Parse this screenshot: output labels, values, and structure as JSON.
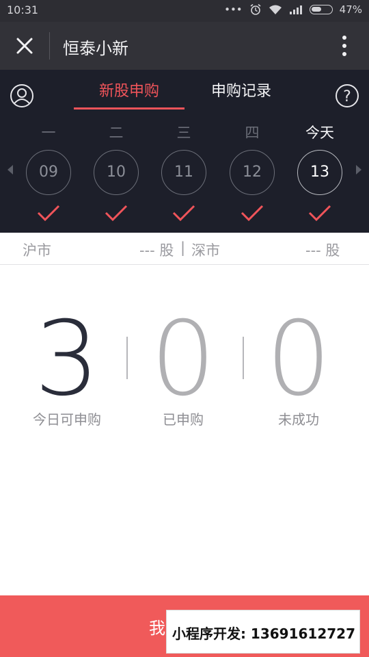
{
  "status": {
    "time": "10:31",
    "battery": "47%"
  },
  "nav": {
    "title": "恒泰小新"
  },
  "tabs": {
    "new_ipo": "新股申购",
    "records": "申购记录"
  },
  "days": [
    {
      "weekday": "一",
      "date": "09"
    },
    {
      "weekday": "二",
      "date": "10"
    },
    {
      "weekday": "三",
      "date": "11"
    },
    {
      "weekday": "四",
      "date": "12"
    },
    {
      "weekday": "今天",
      "date": "13"
    }
  ],
  "market": {
    "sh_label": "沪市",
    "sh_count": "--- 股",
    "separator": "|",
    "sz_label": "深市",
    "sz_count": "--- 股"
  },
  "counters": [
    {
      "value": "3",
      "label": "今日可申购"
    },
    {
      "value": "0",
      "label": "已申购"
    },
    {
      "value": "0",
      "label": "未成功"
    }
  ],
  "bottom": {
    "label": "我"
  },
  "watermark": {
    "text": "小程序开发: 13691612727"
  },
  "colors": {
    "accent": "#f0545a",
    "dark_bg": "#1d1f2a",
    "nav_bg": "#323238"
  }
}
